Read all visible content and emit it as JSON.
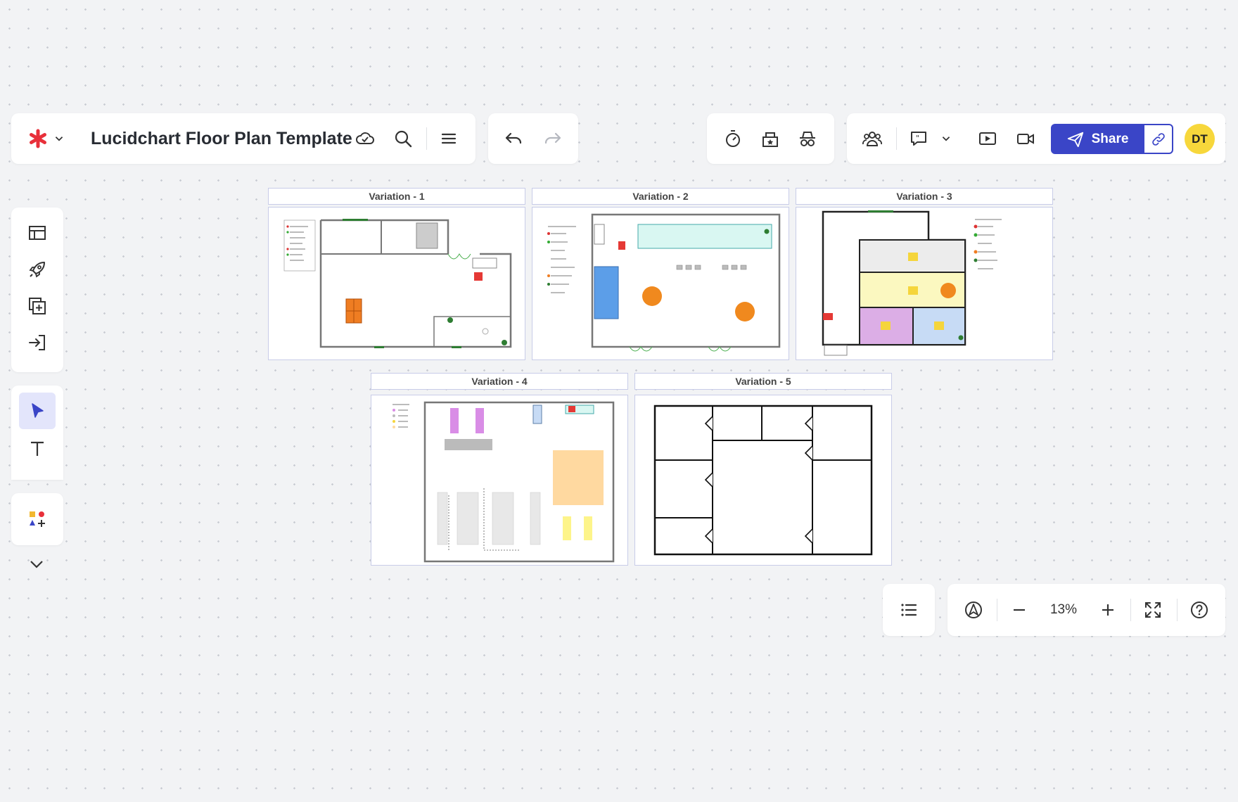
{
  "app": {
    "document_title": "Lucidchart Floor Plan Template"
  },
  "toolbar": {
    "share_label": "Share",
    "avatar_initials": "DT"
  },
  "canvas": {
    "pages": [
      {
        "label": "Variation - 1"
      },
      {
        "label": "Variation - 2"
      },
      {
        "label": "Variation - 3"
      },
      {
        "label": "Variation - 4"
      },
      {
        "label": "Variation - 5"
      }
    ]
  },
  "zoom": {
    "level": "13%"
  },
  "colors": {
    "accent": "#3a45c7",
    "avatar": "#f7d73b",
    "logo": "#e8303a",
    "tool_active_bg": "#e3e5fb"
  },
  "icons": {
    "top_left": [
      "lucid-logo-icon",
      "chevron-down-icon",
      "cloud-check-icon",
      "search-icon",
      "menu-icon"
    ],
    "history": [
      "undo-icon",
      "redo-icon"
    ],
    "collab_tools": [
      "timer-icon",
      "vote-icon",
      "incognito-icon"
    ],
    "share_area": [
      "collaborators-icon",
      "comment-icon",
      "chevron-down-icon",
      "present-icon",
      "video-icon",
      "send-icon",
      "link-icon"
    ],
    "left_rail": [
      "templates-icon",
      "rocket-icon",
      "add-page-icon",
      "import-icon",
      "select-pointer-icon",
      "text-icon",
      "shapes-icon",
      "chevron-down-icon"
    ],
    "bottom_right": [
      "list-icon",
      "navigate-icon",
      "zoom-out-icon",
      "zoom-in-icon",
      "fit-screen-icon",
      "help-icon"
    ]
  }
}
